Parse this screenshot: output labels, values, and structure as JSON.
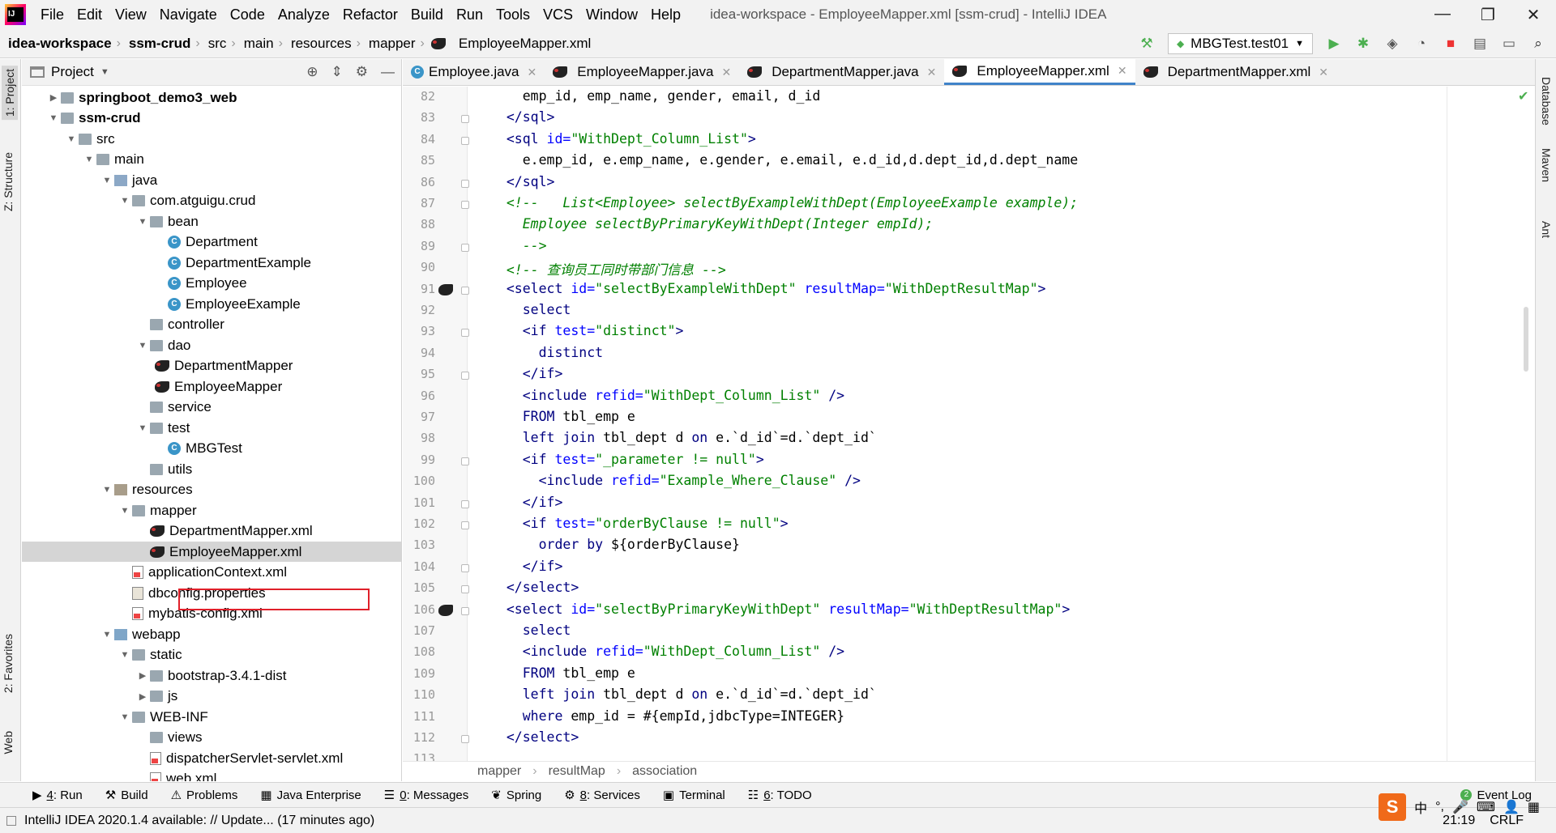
{
  "menubar": {
    "items": [
      "File",
      "Edit",
      "View",
      "Navigate",
      "Code",
      "Analyze",
      "Refactor",
      "Build",
      "Run",
      "Tools",
      "VCS",
      "Window",
      "Help"
    ],
    "window_title": "idea-workspace - EmployeeMapper.xml [ssm-crud] - IntelliJ IDEA"
  },
  "navbar": {
    "crumbs": [
      "idea-workspace",
      "ssm-crud",
      "src",
      "main",
      "resources",
      "mapper",
      "EmployeeMapper.xml"
    ],
    "run_config": "MBGTest.test01"
  },
  "left_strip": {
    "project": "1: Project",
    "structure": "Z: Structure",
    "favorites": "2: Favorites",
    "web": "Web"
  },
  "right_strip": {
    "database": "Database",
    "maven": "Maven",
    "ant": "Ant"
  },
  "project_panel": {
    "title": "Project",
    "tree": [
      {
        "label": "springboot_demo3_web",
        "depth": 1,
        "arrow": "▶",
        "icon": "folder",
        "bold": true
      },
      {
        "label": "ssm-crud",
        "depth": 1,
        "arrow": "▼",
        "icon": "folder",
        "bold": true
      },
      {
        "label": "src",
        "depth": 2,
        "arrow": "▼",
        "icon": "folder"
      },
      {
        "label": "main",
        "depth": 3,
        "arrow": "▼",
        "icon": "folder"
      },
      {
        "label": "java",
        "depth": 4,
        "arrow": "▼",
        "icon": "src"
      },
      {
        "label": "com.atguigu.crud",
        "depth": 5,
        "arrow": "▼",
        "icon": "folder"
      },
      {
        "label": "bean",
        "depth": 6,
        "arrow": "▼",
        "icon": "folder"
      },
      {
        "label": "Department",
        "depth": 7,
        "arrow": "",
        "icon": "class"
      },
      {
        "label": "DepartmentExample",
        "depth": 7,
        "arrow": "",
        "icon": "class"
      },
      {
        "label": "Employee",
        "depth": 7,
        "arrow": "",
        "icon": "class"
      },
      {
        "label": "EmployeeExample",
        "depth": 7,
        "arrow": "",
        "icon": "class"
      },
      {
        "label": "controller",
        "depth": 6,
        "arrow": "",
        "icon": "folder"
      },
      {
        "label": "dao",
        "depth": 6,
        "arrow": "▼",
        "icon": "folder"
      },
      {
        "label": "DepartmentMapper",
        "depth": 7,
        "arrow": "",
        "icon": "bird",
        "shift": -1
      },
      {
        "label": "EmployeeMapper",
        "depth": 7,
        "arrow": "",
        "icon": "bird",
        "shift": -1
      },
      {
        "label": "service",
        "depth": 6,
        "arrow": "",
        "icon": "folder"
      },
      {
        "label": "test",
        "depth": 6,
        "arrow": "▼",
        "icon": "folder"
      },
      {
        "label": "MBGTest",
        "depth": 7,
        "arrow": "",
        "icon": "class"
      },
      {
        "label": "utils",
        "depth": 6,
        "arrow": "",
        "icon": "folder"
      },
      {
        "label": "resources",
        "depth": 4,
        "arrow": "▼",
        "icon": "res"
      },
      {
        "label": "mapper",
        "depth": 5,
        "arrow": "▼",
        "icon": "folder"
      },
      {
        "label": "DepartmentMapper.xml",
        "depth": 6,
        "arrow": "",
        "icon": "bird"
      },
      {
        "label": "EmployeeMapper.xml",
        "depth": 6,
        "arrow": "",
        "icon": "bird",
        "selected": true
      },
      {
        "label": "applicationContext.xml",
        "depth": 5,
        "arrow": "",
        "icon": "xml"
      },
      {
        "label": "dbconfig.properties",
        "depth": 5,
        "arrow": "",
        "icon": "props"
      },
      {
        "label": "mybatis-config.xml",
        "depth": 5,
        "arrow": "",
        "icon": "xml"
      },
      {
        "label": "webapp",
        "depth": 4,
        "arrow": "▼",
        "icon": "web"
      },
      {
        "label": "static",
        "depth": 5,
        "arrow": "▼",
        "icon": "folder"
      },
      {
        "label": "bootstrap-3.4.1-dist",
        "depth": 6,
        "arrow": "▶",
        "icon": "folder"
      },
      {
        "label": "js",
        "depth": 6,
        "arrow": "▶",
        "icon": "folder"
      },
      {
        "label": "WEB-INF",
        "depth": 5,
        "arrow": "▼",
        "icon": "folder"
      },
      {
        "label": "views",
        "depth": 6,
        "arrow": "",
        "icon": "folder"
      },
      {
        "label": "dispatcherServlet-servlet.xml",
        "depth": 6,
        "arrow": "",
        "icon": "xml"
      },
      {
        "label": "web.xml",
        "depth": 6,
        "arrow": "",
        "icon": "xml"
      }
    ]
  },
  "tabs": [
    {
      "label": "Employee.java",
      "icon": "java"
    },
    {
      "label": "EmployeeMapper.java",
      "icon": "bird"
    },
    {
      "label": "DepartmentMapper.java",
      "icon": "bird"
    },
    {
      "label": "EmployeeMapper.xml",
      "icon": "bird",
      "active": true
    },
    {
      "label": "DepartmentMapper.xml",
      "icon": "bird"
    }
  ],
  "editor": {
    "lines": [
      {
        "n": "82",
        "segs": [
          [
            "tx",
            "    emp_id, emp_name, gender, email, d_id"
          ]
        ]
      },
      {
        "n": "83",
        "fold": true,
        "segs": [
          [
            "t",
            "  </sql>"
          ]
        ]
      },
      {
        "n": "84",
        "fold": true,
        "segs": [
          [
            "t",
            "  <sql "
          ],
          [
            "a",
            "id="
          ],
          [
            "v",
            "\"WithDept_Column_List\""
          ],
          [
            "t",
            ">"
          ]
        ]
      },
      {
        "n": "85",
        "segs": [
          [
            "tx",
            "    e.emp_id, e.emp_name, e.gender, e.email, e.d_id,d.dept_id,d.dept_name"
          ]
        ]
      },
      {
        "n": "86",
        "fold": true,
        "segs": [
          [
            "t",
            "  </sql>"
          ]
        ]
      },
      {
        "n": "87",
        "fold": true,
        "segs": [
          [
            "c",
            "  <!--   List<Employee> selectByExampleWithDept(EmployeeExample example);"
          ]
        ]
      },
      {
        "n": "88",
        "segs": [
          [
            "c",
            "    Employee selectByPrimaryKeyWithDept(Integer empId);"
          ]
        ]
      },
      {
        "n": "89",
        "fold": true,
        "segs": [
          [
            "c",
            "    -->"
          ]
        ]
      },
      {
        "n": "90",
        "segs": [
          [
            "c",
            "  <!-- 查询员工同时带部门信息 -->"
          ]
        ]
      },
      {
        "n": "91",
        "icon": true,
        "fold": true,
        "segs": [
          [
            "t",
            "  <select "
          ],
          [
            "a",
            "id="
          ],
          [
            "v",
            "\"selectByExampleWithDept\" "
          ],
          [
            "a",
            "resultMap="
          ],
          [
            "v",
            "\"WithDeptResultMap\""
          ],
          [
            "t",
            ">"
          ]
        ]
      },
      {
        "n": "92",
        "segs": [
          [
            "k",
            "    select"
          ]
        ]
      },
      {
        "n": "93",
        "fold": true,
        "segs": [
          [
            "t",
            "    <if "
          ],
          [
            "a",
            "test="
          ],
          [
            "v",
            "\"distinct\""
          ],
          [
            "t",
            ">"
          ]
        ]
      },
      {
        "n": "94",
        "segs": [
          [
            "k",
            "      distinct"
          ]
        ]
      },
      {
        "n": "95",
        "fold": true,
        "segs": [
          [
            "t",
            "    </if>"
          ]
        ]
      },
      {
        "n": "96",
        "segs": [
          [
            "t",
            "    <include "
          ],
          [
            "a",
            "refid="
          ],
          [
            "v",
            "\"WithDept_Column_List\""
          ],
          [
            "t",
            " />"
          ]
        ]
      },
      {
        "n": "97",
        "segs": [
          [
            "k",
            "    FROM "
          ],
          [
            "tx",
            "tbl_emp e"
          ]
        ]
      },
      {
        "n": "98",
        "segs": [
          [
            "k",
            "    left join "
          ],
          [
            "tx",
            "tbl_dept d "
          ],
          [
            "k",
            "on "
          ],
          [
            "tx",
            "e.`d_id`=d.`dept_id`"
          ]
        ]
      },
      {
        "n": "99",
        "fold": true,
        "segs": [
          [
            "t",
            "    <if "
          ],
          [
            "a",
            "test="
          ],
          [
            "v",
            "\"_parameter != null\""
          ],
          [
            "t",
            ">"
          ]
        ]
      },
      {
        "n": "100",
        "segs": [
          [
            "t",
            "      <include "
          ],
          [
            "a",
            "refid="
          ],
          [
            "v",
            "\"Example_Where_Clause\""
          ],
          [
            "t",
            " />"
          ]
        ]
      },
      {
        "n": "101",
        "fold": true,
        "segs": [
          [
            "t",
            "    </if>"
          ]
        ]
      },
      {
        "n": "102",
        "fold": true,
        "segs": [
          [
            "t",
            "    <if "
          ],
          [
            "a",
            "test="
          ],
          [
            "v",
            "\"orderByClause != null\""
          ],
          [
            "t",
            ">"
          ]
        ]
      },
      {
        "n": "103",
        "segs": [
          [
            "k",
            "      order by "
          ],
          [
            "tx",
            "${orderByClause}"
          ]
        ]
      },
      {
        "n": "104",
        "fold": true,
        "segs": [
          [
            "t",
            "    </if>"
          ]
        ]
      },
      {
        "n": "105",
        "fold": true,
        "segs": [
          [
            "t",
            "  </select>"
          ]
        ]
      },
      {
        "n": "106",
        "icon": true,
        "fold": true,
        "segs": [
          [
            "t",
            "  <select "
          ],
          [
            "a",
            "id="
          ],
          [
            "v",
            "\"selectByPrimaryKeyWithDept\" "
          ],
          [
            "a",
            "resultMap="
          ],
          [
            "v",
            "\"WithDeptResultMap\""
          ],
          [
            "t",
            ">"
          ]
        ]
      },
      {
        "n": "107",
        "segs": [
          [
            "k",
            "    select"
          ]
        ]
      },
      {
        "n": "108",
        "segs": [
          [
            "t",
            "    <include "
          ],
          [
            "a",
            "refid="
          ],
          [
            "v",
            "\"WithDept_Column_List\""
          ],
          [
            "t",
            " />"
          ]
        ]
      },
      {
        "n": "109",
        "segs": [
          [
            "k",
            "    FROM "
          ],
          [
            "tx",
            "tbl_emp e"
          ]
        ]
      },
      {
        "n": "110",
        "segs": [
          [
            "k",
            "    left join "
          ],
          [
            "tx",
            "tbl_dept d "
          ],
          [
            "k",
            "on "
          ],
          [
            "tx",
            "e.`d_id`=d.`dept_id`"
          ]
        ]
      },
      {
        "n": "111",
        "segs": [
          [
            "k",
            "    where "
          ],
          [
            "tx",
            "emp_id = #{empId,jdbcType=INTEGER}"
          ]
        ]
      },
      {
        "n": "112",
        "fold": true,
        "segs": [
          [
            "t",
            "  </select>"
          ]
        ]
      },
      {
        "n": "113",
        "segs": []
      }
    ]
  },
  "editor_breadcrumb": [
    "mapper",
    "resultMap",
    "association"
  ],
  "toolwindows": [
    {
      "num": "4",
      "label": ": Run",
      "icon": "▶"
    },
    {
      "num": "",
      "label": "Build",
      "icon": "⚒"
    },
    {
      "num": "",
      "label": "Problems",
      "icon": "⚠"
    },
    {
      "num": "",
      "label": "Java Enterprise",
      "icon": "▦"
    },
    {
      "num": "0",
      "label": ": Messages",
      "icon": "☰"
    },
    {
      "num": "",
      "label": "Spring",
      "icon": "❦"
    },
    {
      "num": "8",
      "label": ": Services",
      "icon": "⚙"
    },
    {
      "num": "",
      "label": "Terminal",
      "icon": "▣"
    },
    {
      "num": "6",
      "label": ": TODO",
      "icon": "☷"
    }
  ],
  "event_log": {
    "count": "2",
    "label": "Event Log"
  },
  "statusbar": {
    "message": "IntelliJ IDEA 2020.1.4 available: // Update... (17 minutes ago)",
    "position": "21:19",
    "line_ending": "CRLF"
  }
}
